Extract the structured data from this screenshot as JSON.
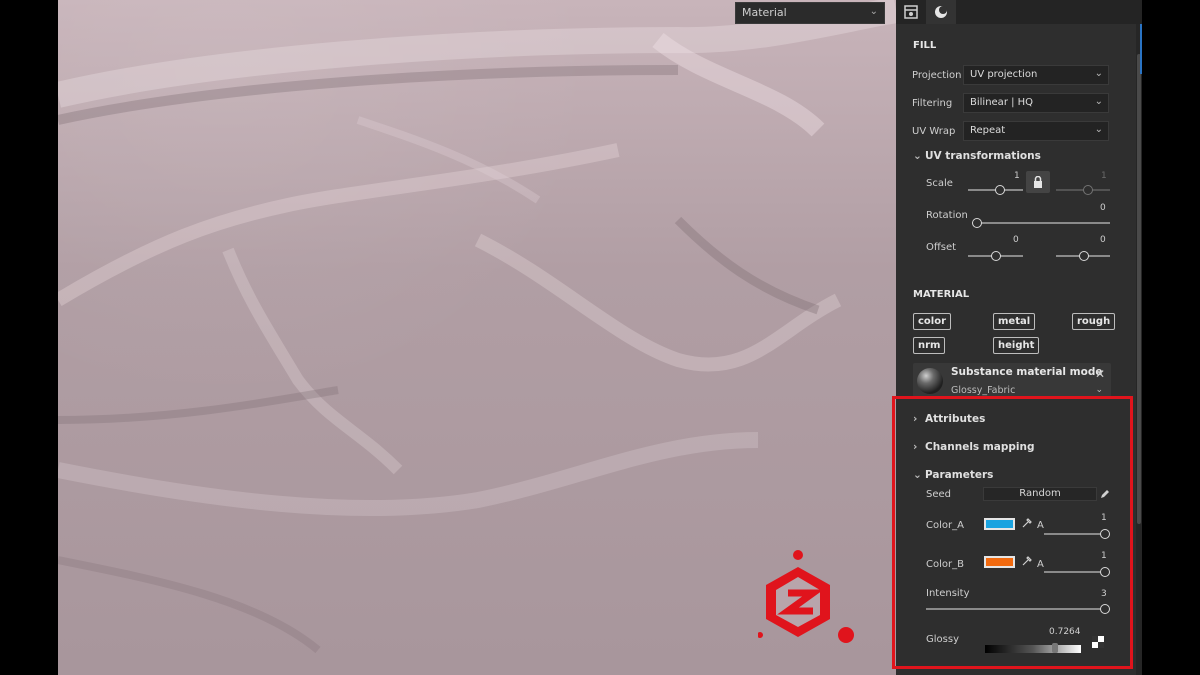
{
  "viewport": {
    "material_dropdown": "Material"
  },
  "panel": {
    "fill": {
      "title": "FILL",
      "projection": {
        "label": "Projection",
        "value": "UV projection"
      },
      "filtering": {
        "label": "Filtering",
        "value": "Bilinear | HQ"
      },
      "uv_wrap": {
        "label": "UV Wrap",
        "value": "Repeat"
      }
    },
    "uv_transformations": {
      "title": "UV transformations",
      "scale": {
        "label": "Scale",
        "value_u": "1",
        "value_v": "1"
      },
      "rotation": {
        "label": "Rotation",
        "value": "0"
      },
      "offset": {
        "label": "Offset",
        "value_u": "0",
        "value_v": "0"
      }
    },
    "material": {
      "title": "MATERIAL",
      "channels": [
        "color",
        "metal",
        "rough",
        "nrm",
        "height"
      ],
      "card_title": "Substance material mode",
      "card_subtitle": "Glossy_Fabric"
    },
    "attributes": {
      "title": "Attributes"
    },
    "channels_mapping": {
      "title": "Channels mapping"
    },
    "parameters": {
      "title": "Parameters",
      "seed": {
        "label": "Seed",
        "button": "Random"
      },
      "color_a": {
        "label": "Color_A",
        "color": "#1aa3e0",
        "alpha_label": "A",
        "alpha": "1",
        "alpha_level": 1
      },
      "color_b": {
        "label": "Color_B",
        "color": "#f26a0f",
        "alpha_label": "A",
        "alpha": "1",
        "alpha_level": 1
      },
      "intensity": {
        "label": "Intensity",
        "value": "3",
        "level": 1
      },
      "glossy": {
        "label": "Glossy",
        "value": "0.7264",
        "level": 0.7264
      }
    }
  },
  "colors": {
    "highlight": "#e0141c",
    "panel_bg": "#2e2e2e",
    "fabric": "#b8a5ab"
  }
}
